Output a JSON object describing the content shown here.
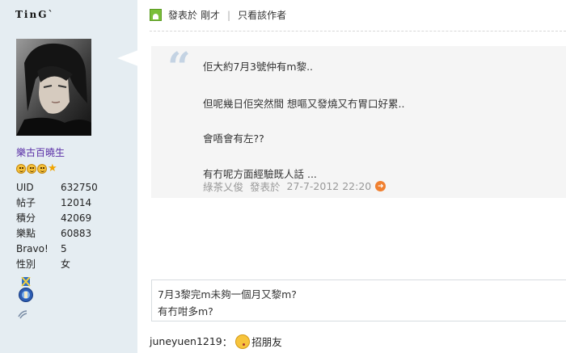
{
  "user": {
    "name": "TinG`",
    "rank": "樂古百曉生",
    "stats": [
      {
        "label": "UID",
        "value": "632750"
      },
      {
        "label": "帖子",
        "value": "12014"
      },
      {
        "label": "積分",
        "value": "42069"
      },
      {
        "label": "樂點",
        "value": "60883"
      },
      {
        "label": "Bravo!",
        "value": "5"
      },
      {
        "label": "性別",
        "value": "女"
      }
    ]
  },
  "post": {
    "posted_prefix": "發表於",
    "posted_time": "剛才",
    "separator": "|",
    "only_author": "只看該作者",
    "quote": {
      "lines": [
        "佢大約7月3號仲有m黎..",
        "但呢幾日佢突然間 想嘔又發燒又冇胃口好累..",
        "會唔會有左??",
        "有冇呢方面經驗既人話 ..."
      ],
      "author": "綠茶乂俊",
      "posted_label": "發表於",
      "time": "27-7-2012 22:20"
    },
    "reply_lines": [
      "7月3黎完m未夠一個月又黎m?",
      "有冇咁多m?"
    ]
  },
  "signature": {
    "name": "juneyuen1219",
    "colon": "：",
    "text": "招朋友"
  }
}
